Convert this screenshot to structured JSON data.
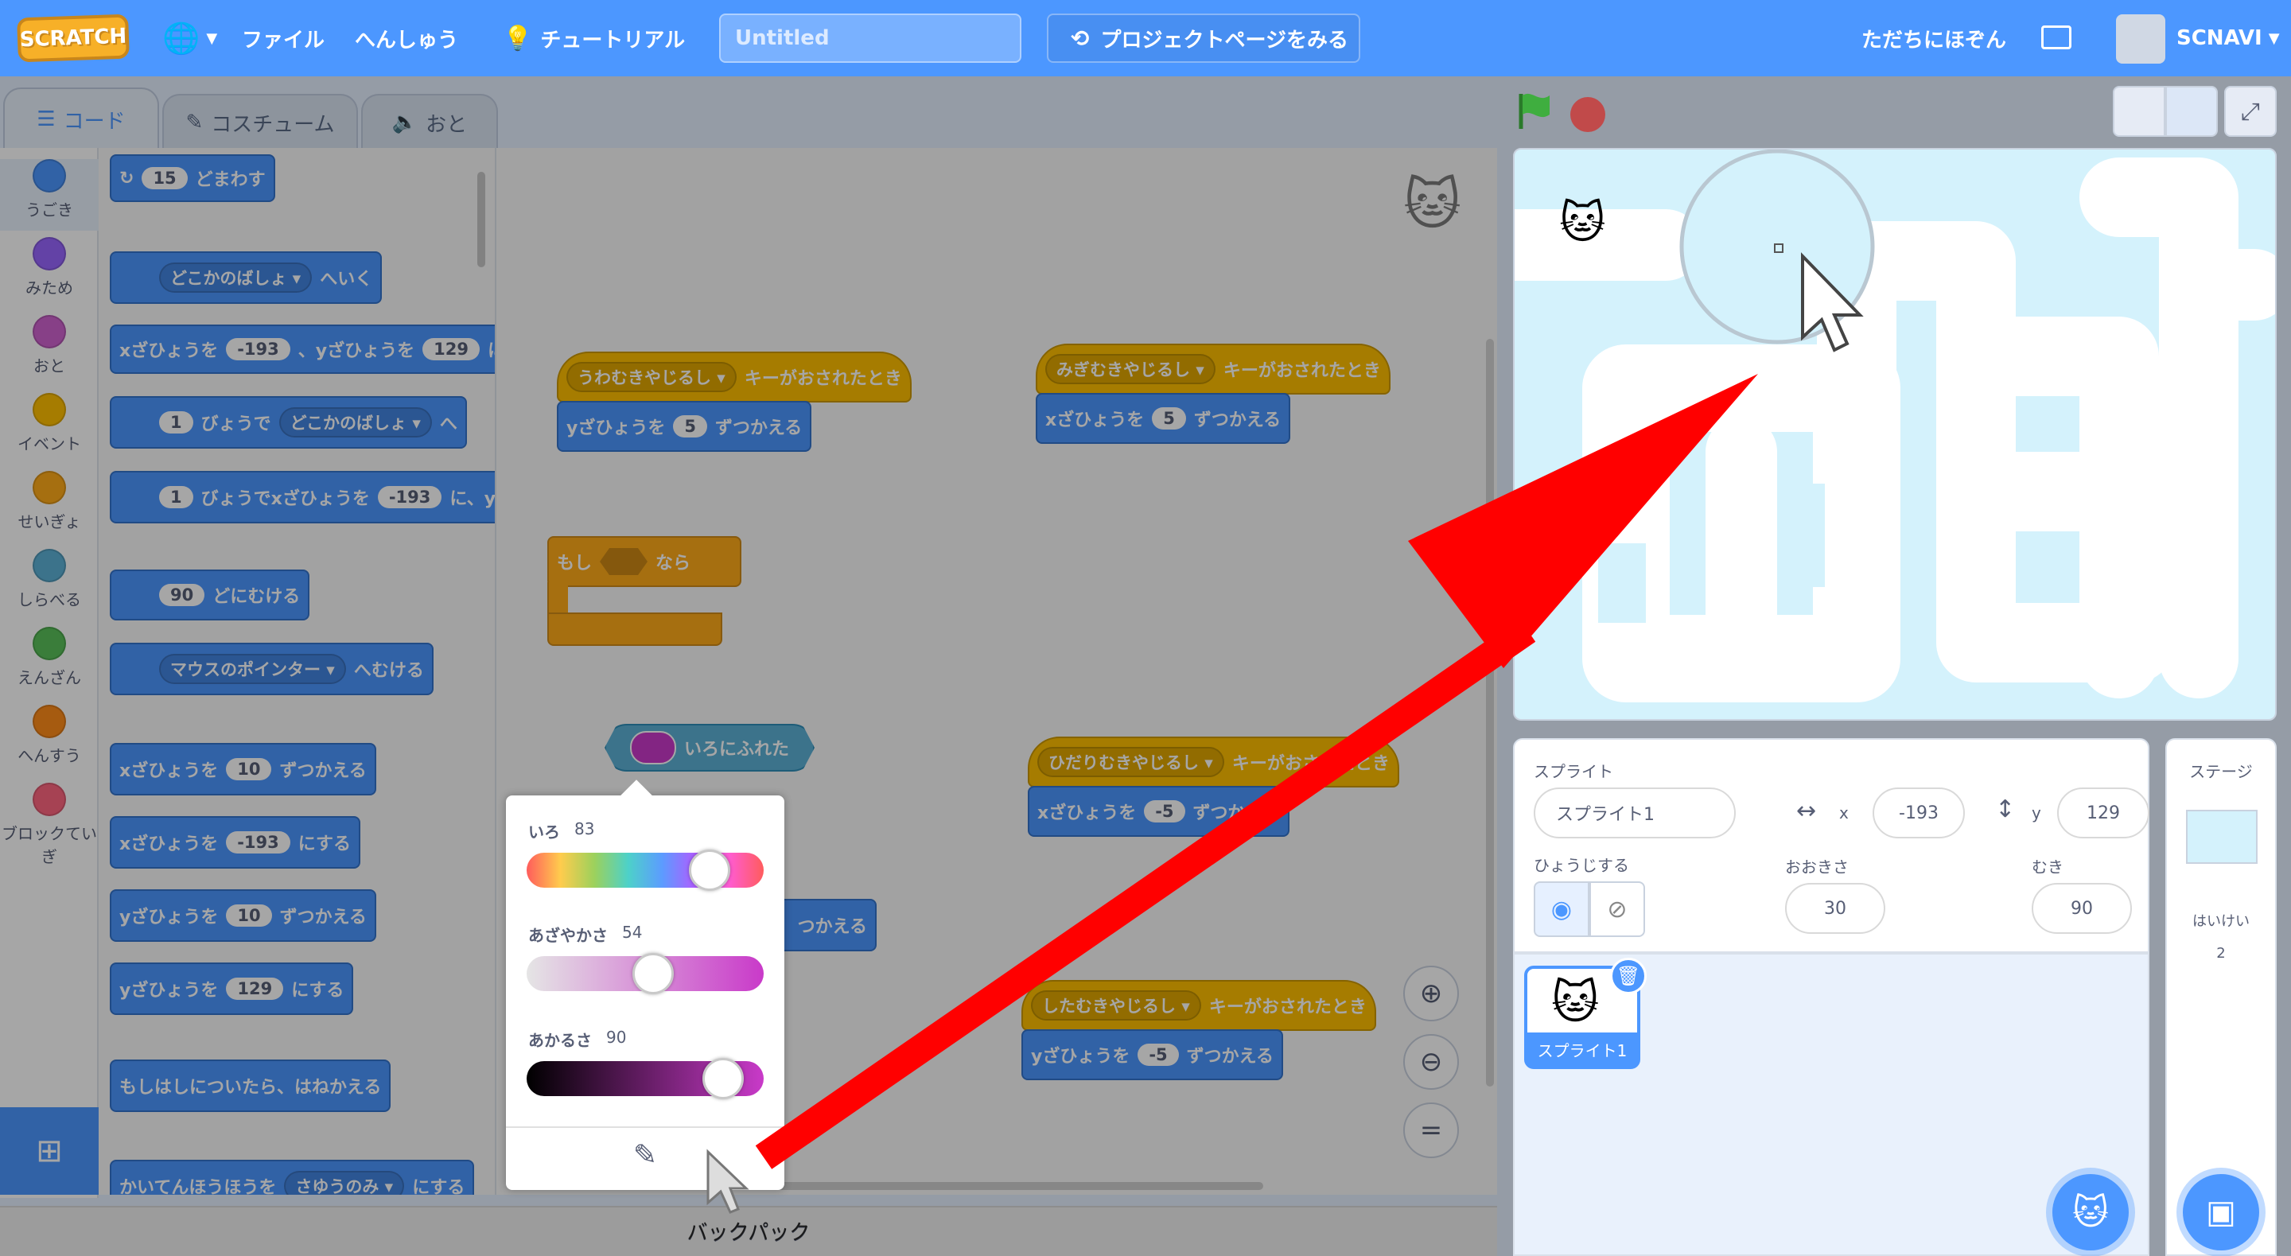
{
  "menubar": {
    "logo": "SCRATCH",
    "file": "ファイル",
    "edit": "へんしゅう",
    "tutorial": "チュートリアル",
    "project_title": "Untitled",
    "see_project_page": "プロジェクトページをみる",
    "save_now": "ただちにほぞん",
    "username": "SCNAVI"
  },
  "tabs": {
    "code": "コード",
    "costume": "コスチューム",
    "sound": "おと"
  },
  "categories": [
    {
      "label": "うごき",
      "color": "#4c97ff"
    },
    {
      "label": "みため",
      "color": "#9966ff"
    },
    {
      "label": "おと",
      "color": "#cf63cf"
    },
    {
      "label": "イベント",
      "color": "#ffbf00"
    },
    {
      "label": "せいぎょ",
      "color": "#ffab19"
    },
    {
      "label": "しらべる",
      "color": "#5cb1d6"
    },
    {
      "label": "えんざん",
      "color": "#59c059"
    },
    {
      "label": "へんすう",
      "color": "#ff8c1a"
    },
    {
      "label": "ブロックていぎ",
      "color": "#ff6680"
    }
  ],
  "palette": {
    "turn_val": "15",
    "turn_text": "どまわす",
    "goto_dd": "どこかのばしょ",
    "goto_text": "へいく",
    "gotoxy_a": "xざひょうを",
    "gotoxy_x": "-193",
    "gotoxy_b": "、yざひょうを",
    "gotoxy_y": "129",
    "gotoxy_c": "に",
    "glide_sec": "1",
    "glide_a": "びょうで",
    "glide_dd": "どこかのばしょ",
    "glide_b": "へ",
    "glidexy_sec": "1",
    "glidexy_a": "びょうでxざひょうを",
    "glidexy_x": "-193",
    "glidexy_b": "に、y",
    "point_val": "90",
    "point_text": "どにむける",
    "toward_dd": "マウスのポインター",
    "toward_text": "へむける",
    "changex_a": "xざひょうを",
    "changex_v": "10",
    "changex_b": "ずつかえる",
    "setx_a": "xざひょうを",
    "setx_v": "-193",
    "setx_b": "にする",
    "changey_a": "yざひょうを",
    "changey_v": "10",
    "changey_b": "ずつかえる",
    "sety_a": "yざひょうを",
    "sety_v": "129",
    "sety_b": "にする",
    "bounce": "もしはしについたら、はねかえる",
    "rot_a": "かいてんほうほうを",
    "rot_dd": "さゆうのみ",
    "rot_b": "にする"
  },
  "script": {
    "up_key": "うわむきやじるし",
    "key_pressed": "キーがおされたとき",
    "up_a": "yざひょうを",
    "up_v": "5",
    "up_b": "ずつかえる",
    "right_key": "みぎむきやじるし",
    "right_pressed": "キーがおされたとき",
    "right_a": "xざひょうを",
    "right_v": "5",
    "right_b": "ずつかえる",
    "if_a": "もし",
    "if_b": "なら",
    "touch_color": "いろにふれた",
    "left_key": "ひだりむきやじるし",
    "left_pressed": "キーがおされたとき",
    "left_a": "xざひょうを",
    "left_v": "-5",
    "left_b": "ずつかえる",
    "down_key": "したむきやじるし",
    "down_pressed": "キーがおされたとき",
    "down_a": "yざひょうを",
    "down_v": "-5",
    "down_b": "ずつかえる",
    "hidden_b": "つかえる"
  },
  "color_picker": {
    "hue_label": "いろ",
    "hue_value": "83",
    "sat_label": "あざやかさ",
    "sat_value": "54",
    "bri_label": "あかるさ",
    "bri_value": "90",
    "hue_fraction": 0.83,
    "sat_fraction": 0.54,
    "bri_fraction": 0.9
  },
  "backpack": "バックパック",
  "sprite_info": {
    "sprite_label": "スプライト",
    "sprite_name": "スプライト1",
    "x_label": "x",
    "x_value": "-193",
    "y_label": "y",
    "y_value": "129",
    "show_label": "ひょうじする",
    "size_label": "おおきさ",
    "size_value": "30",
    "direction_label": "むき",
    "direction_value": "90"
  },
  "sprite_list": [
    {
      "name": "スプライト1"
    }
  ],
  "stage_panel": {
    "title": "ステージ",
    "backdrops_label": "はいけい",
    "backdrops_count": "2"
  },
  "colors": {
    "menubar": "#4c97ff",
    "motion": "#4c97ff",
    "events": "#ffbf00",
    "control": "#ffab19",
    "sensing": "#5cb1d6",
    "arrow": "#ff0000"
  }
}
